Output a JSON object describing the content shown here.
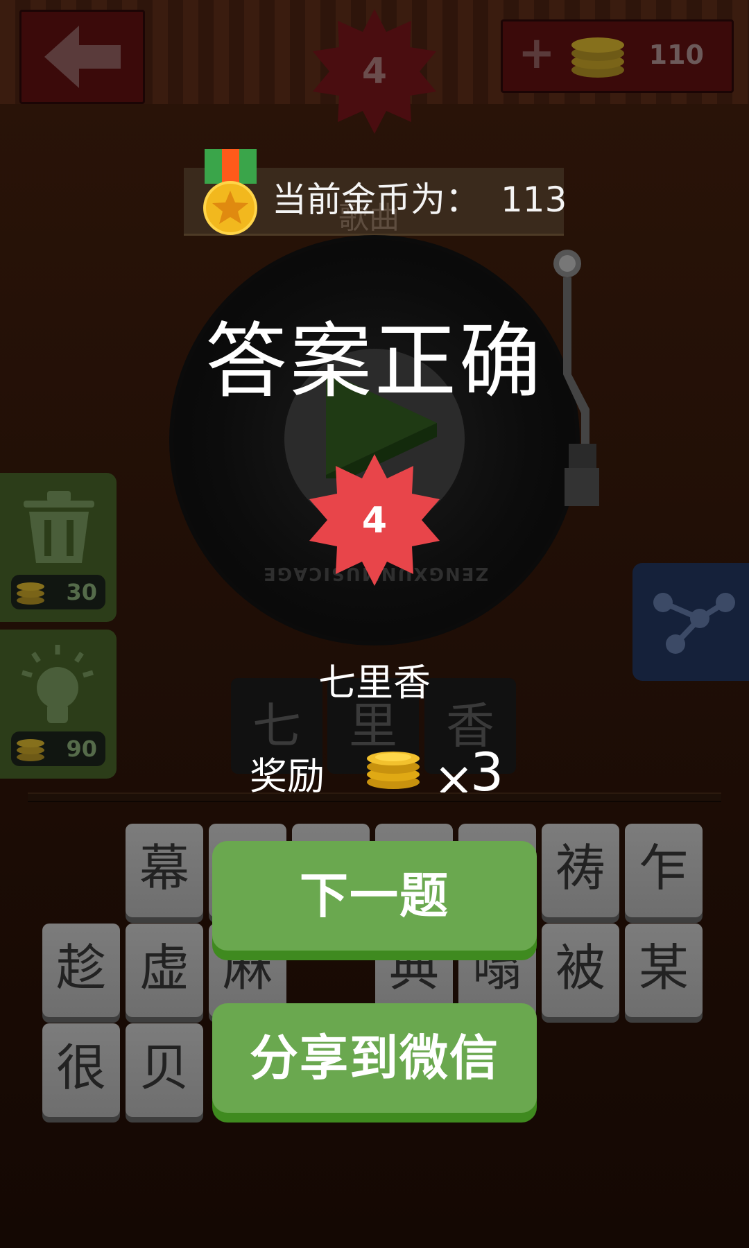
{
  "header": {
    "back_label": "back",
    "level_badge_number": "4",
    "coins_balance": "110"
  },
  "banner": {
    "coins_text": "当前金币为：",
    "coins_value": "113",
    "ghost_song_text": "歌曲"
  },
  "record": {
    "ring_text": "ZENGXUNMUSICAGE"
  },
  "dialog": {
    "title": "答案正确",
    "level_number": "4",
    "song_name": "七里香",
    "reward_label": "奖励",
    "reward_multiplier": "×",
    "reward_count": "3",
    "next_button": "下一题",
    "share_button": "分享到微信"
  },
  "answer_slots": [
    "七",
    "里",
    "香"
  ],
  "side_buttons": {
    "delete_price": "30",
    "hint_price": "90"
  },
  "keyboard": {
    "row1": [
      "",
      "幕",
      "",
      "",
      "",
      "",
      "祷",
      "乍"
    ],
    "row2": [
      "趁",
      "虚",
      "麻",
      "",
      "典",
      "嗡",
      "被",
      "某"
    ],
    "row3": [
      "很",
      "贝"
    ]
  },
  "colors": {
    "accent_green": "#6aa84f",
    "badge_red": "#e8454a",
    "coin_gold": "#f2c12e"
  }
}
